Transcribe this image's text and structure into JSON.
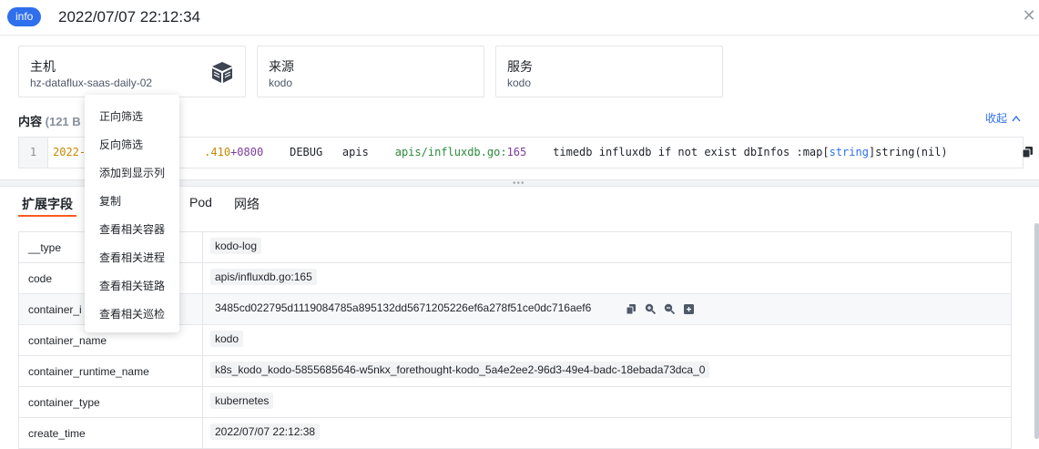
{
  "header": {
    "badge": "info",
    "title": "2022/07/07 22:12:34"
  },
  "cards": [
    {
      "label": "主机",
      "value": "hz-dataflux-saas-daily-02",
      "icon": "cube-icon"
    },
    {
      "label": "来源",
      "value": "kodo"
    },
    {
      "label": "服务",
      "value": "kodo"
    }
  ],
  "content": {
    "label": "内容",
    "size": "(121 B",
    "collapse_label": "收起"
  },
  "log": {
    "line_no": "1",
    "timestamp_prefix": "2022-",
    "timestamp_suffix": ".410",
    "timezone": "+0800",
    "level": "DEBUG",
    "module": "apis",
    "source_file": "apis/influxdb.go:",
    "source_line": "165",
    "message_pre": "timedb influxdb if not exist dbInfos :map[",
    "message_kw": "string",
    "message_post": "]string(nil)"
  },
  "tabs": [
    {
      "label": "扩展字段",
      "active": true
    },
    {
      "label": "Pod",
      "active": false
    },
    {
      "label": "网络",
      "active": false
    }
  ],
  "fields": [
    {
      "key": "__type",
      "value": "kodo-log"
    },
    {
      "key": "code",
      "value": "apis/influxdb.go:165"
    },
    {
      "key": "container_i",
      "value": "3485cd022795d1119084785a895132dd5671205226ef6a278f51ce0dc716aef6"
    },
    {
      "key": "container_name",
      "value": "kodo"
    },
    {
      "key": "container_runtime_name",
      "value": "k8s_kodo_kodo-5855685646-w5nkx_forethought-kodo_5a4e2ee2-96d3-49e4-badc-18ebada73dca_0"
    },
    {
      "key": "container_type",
      "value": "kubernetes"
    },
    {
      "key": "create_time",
      "value": "2022/07/07 22:12:38"
    }
  ],
  "context_menu": [
    "正向筛选",
    "反向筛选",
    "添加到显示列",
    "复制",
    "查看相关容器",
    "查看相关进程",
    "查看相关链路",
    "查看相关巡检"
  ],
  "colors": {
    "accent": "#2f6fed",
    "tab_underline": "#ff5a1f"
  }
}
